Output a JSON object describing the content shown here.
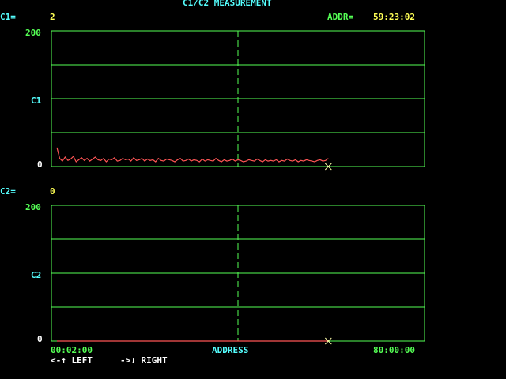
{
  "title": "C1/C2 MEASUREMENT",
  "c1": {
    "label": "C1=",
    "value": "2",
    "axis_top": "200",
    "axis_mid": "C1",
    "axis_bottom": "0"
  },
  "c2": {
    "label": "C2=",
    "value": "0",
    "axis_top": "200",
    "axis_mid": "C2",
    "axis_bottom": "0"
  },
  "addr": {
    "label": "ADDR=",
    "value": "59:23:02"
  },
  "x_axis": {
    "start": "00:02:00",
    "label": "ADDRESS",
    "end": "80:00:00"
  },
  "nav": {
    "left": "<-↑ LEFT",
    "right": "->↓ RIGHT"
  },
  "colors": {
    "grid": "#55ff55",
    "trace": "#ff5555",
    "cursor": "#ffffaa",
    "label": "#55ffff",
    "value": "#ffff55"
  },
  "chart_data": [
    {
      "type": "line",
      "name": "C1",
      "ylim": [
        0,
        200
      ],
      "x_start": "00:02:00",
      "x_end": "80:00:00",
      "cursor_x": "59:23:02",
      "grid": true,
      "y": [
        28,
        12,
        8,
        14,
        9,
        11,
        15,
        7,
        10,
        13,
        9,
        12,
        8,
        11,
        14,
        10,
        9,
        12,
        7,
        11,
        10,
        13,
        8,
        9,
        12,
        10,
        11,
        8,
        13,
        9,
        10,
        12,
        8,
        11,
        9,
        10,
        7,
        12,
        9,
        8,
        11,
        10,
        9,
        7,
        10,
        12,
        8,
        9,
        11,
        8,
        10,
        9,
        7,
        11,
        8,
        10,
        9,
        8,
        12,
        9,
        7,
        10,
        8,
        9,
        11,
        8,
        10,
        9,
        7,
        8,
        10,
        9,
        8,
        11,
        9,
        7,
        10,
        8,
        9,
        8,
        10,
        7,
        9,
        8,
        11,
        9,
        8,
        10,
        7,
        9,
        8,
        10,
        9,
        8,
        7,
        9,
        10,
        8,
        9,
        12
      ]
    },
    {
      "type": "line",
      "name": "C2",
      "ylim": [
        0,
        200
      ],
      "x_start": "00:02:00",
      "x_end": "80:00:00",
      "cursor_x": "59:23:02",
      "grid": true,
      "y": [
        0,
        0,
        0,
        0,
        0,
        0,
        0,
        0,
        0,
        0,
        0,
        0,
        0,
        0,
        0,
        0,
        0,
        0,
        0,
        0,
        0,
        0,
        0,
        0,
        0,
        0,
        0,
        0,
        0,
        0,
        0,
        0,
        0,
        0,
        0,
        0,
        0,
        0,
        0,
        0,
        0,
        0,
        0,
        0,
        0,
        0,
        0,
        0,
        0,
        0,
        0,
        0,
        0,
        0,
        0,
        0,
        0,
        0,
        0,
        0,
        0,
        0,
        0,
        0,
        0,
        0,
        0,
        0,
        0,
        0,
        0,
        0,
        0,
        0,
        0,
        0,
        0,
        0,
        0,
        0,
        0,
        0,
        0,
        0,
        0,
        0,
        0,
        0,
        0,
        0,
        0,
        0,
        0,
        0,
        0,
        0,
        0,
        0,
        0,
        0
      ]
    }
  ]
}
